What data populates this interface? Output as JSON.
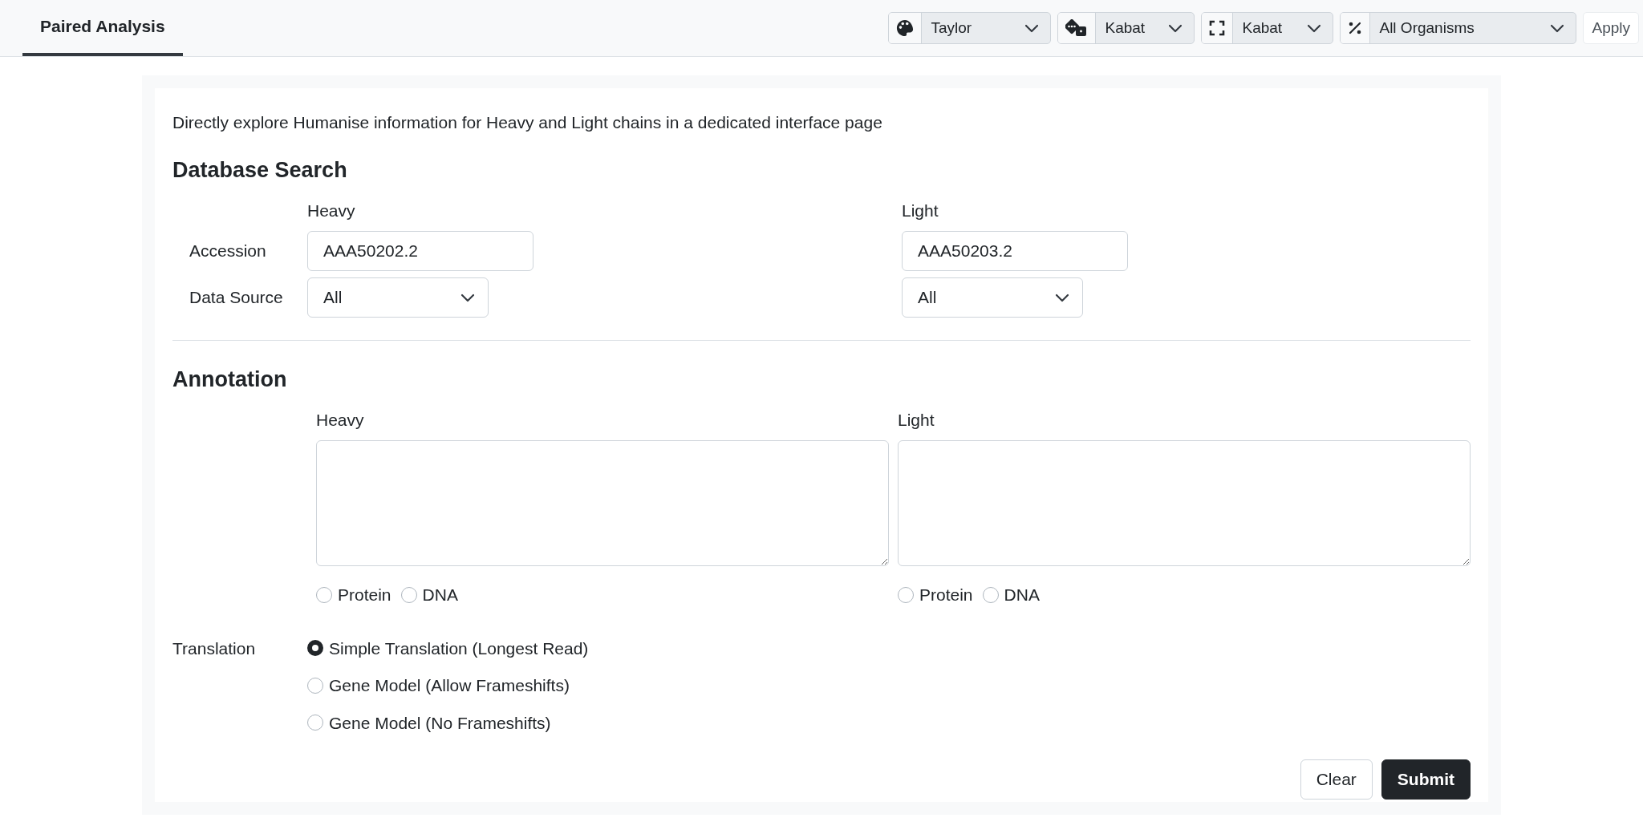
{
  "top_bar": {
    "tabs": [
      {
        "label": "Paired Analysis",
        "selected": true
      }
    ],
    "selectors": [
      {
        "kind": "palette",
        "value": "Taylor"
      },
      {
        "kind": "dice",
        "value": "Kabat"
      },
      {
        "kind": "frame",
        "value": "Kabat"
      },
      {
        "kind": "percent",
        "value": "All Organisms"
      }
    ],
    "apply_button": "Apply"
  },
  "form": {
    "description": "Directly explore Humanise information for Heavy and Light chains in a dedicated interface page",
    "database_search": {
      "title": "Database Search",
      "accession_label": "Accession",
      "data_source_label": "Data Source",
      "columns": [
        {
          "heading": "Heavy",
          "accession": "AAA50202.2",
          "data_source": "All"
        },
        {
          "heading": "Light",
          "accession": "AAA50203.2",
          "data_source": "All"
        }
      ]
    },
    "annotation": {
      "title": "Annotation",
      "columns": [
        {
          "heading": "Heavy",
          "sequence_types": [
            {
              "label": "Protein",
              "selected": false
            },
            {
              "label": "DNA",
              "selected": false
            }
          ]
        },
        {
          "heading": "Light",
          "sequence_types": [
            {
              "label": "Protein",
              "selected": false
            },
            {
              "label": "DNA",
              "selected": false
            }
          ]
        }
      ]
    },
    "translation": {
      "label": "Translation",
      "options": [
        {
          "label": "Simple Translation (Longest Read)",
          "selected": true
        },
        {
          "label": "Gene Model (Allow Frameshifts)",
          "selected": false
        },
        {
          "label": "Gene Model (No Frameshifts)",
          "selected": false
        }
      ]
    },
    "buttons": [
      {
        "kind": "secondary",
        "label": "Clear"
      },
      {
        "kind": "primary",
        "label": "Submit"
      }
    ]
  }
}
